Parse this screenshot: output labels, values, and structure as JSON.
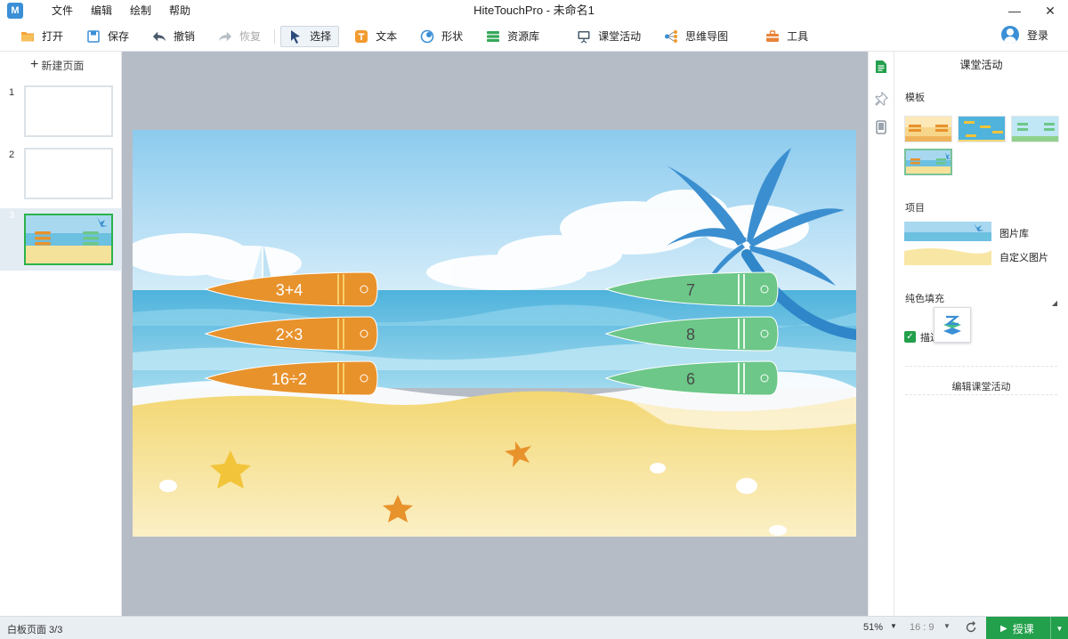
{
  "window": {
    "title": "HiteTouchPro - 未命名1",
    "logo_text": "M"
  },
  "menu": [
    "文件",
    "编辑",
    "绘制",
    "帮助"
  ],
  "toolbar": {
    "open": "打开",
    "save": "保存",
    "undo": "撤销",
    "redo": "恢复",
    "select": "选择",
    "text": "文本",
    "shape": "形状",
    "resources": "资源库",
    "classroom": "课堂活动",
    "mindmap": "思维导图",
    "tools": "工具",
    "login": "登录"
  },
  "pages_panel": {
    "new_page": "新建页面",
    "pages": [
      {
        "num": "1"
      },
      {
        "num": "2"
      },
      {
        "num": "3",
        "selected": true
      }
    ]
  },
  "slide": {
    "left_boards": [
      "3+4",
      "2×3",
      "16÷2"
    ],
    "right_boards": [
      "7",
      "8",
      "6"
    ],
    "left_color": "#e8922c",
    "right_color": "#6cc788"
  },
  "props": {
    "title": "课堂活动",
    "template_label": "模板",
    "item_label": "项目",
    "image_library": "图片库",
    "custom_image": "自定义图片",
    "solid_fill": "纯色填充",
    "check_label": "描边",
    "edit_activity": "编辑课堂活动"
  },
  "status": {
    "page_info": "白板页面 3/3",
    "zoom": "51%",
    "ratio": "16 : 9",
    "start": "授课"
  },
  "colors": {
    "accent_green": "#22a04b",
    "brand_blue": "#3a8fd6"
  }
}
